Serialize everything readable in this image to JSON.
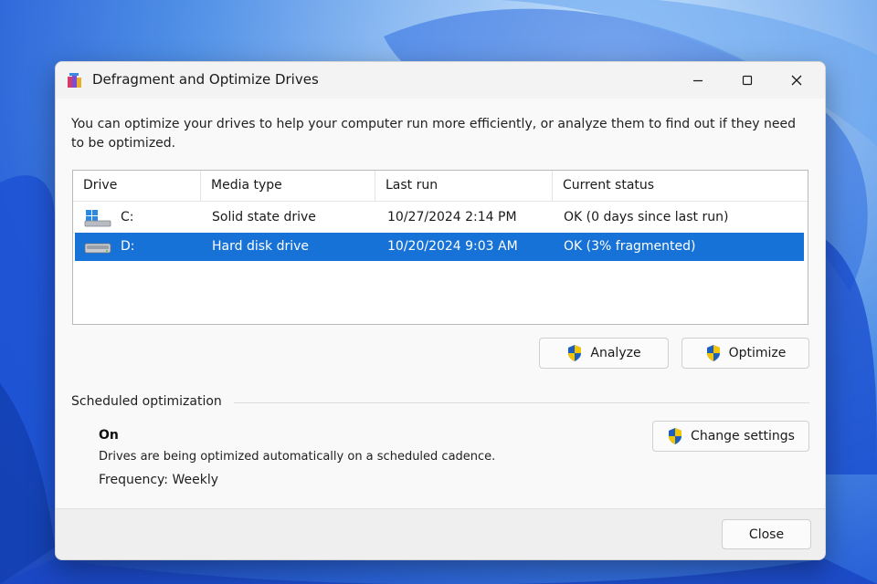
{
  "window": {
    "title": "Defragment and Optimize Drives",
    "controls": {
      "minimize": "minimize",
      "maximize": "maximize",
      "close": "close"
    }
  },
  "description": "You can optimize your drives to help your computer run more efficiently, or analyze them to find out if they need to be optimized.",
  "drives": {
    "columns": [
      "Drive",
      "Media type",
      "Last run",
      "Current status"
    ],
    "rows": [
      {
        "drive": "C:",
        "icon": "windows-drive-icon",
        "media_type": "Solid state drive",
        "last_run": "10/27/2024 2:14 PM",
        "status": "OK (0 days since last run)",
        "selected": false
      },
      {
        "drive": "D:",
        "icon": "hard-disk-icon",
        "media_type": "Hard disk drive",
        "last_run": "10/20/2024 9:03 AM",
        "status": "OK (3% fragmented)",
        "selected": true
      }
    ]
  },
  "buttons": {
    "analyze": "Analyze",
    "optimize": "Optimize",
    "change_settings": "Change settings",
    "close": "Close"
  },
  "scheduled": {
    "heading": "Scheduled optimization",
    "state": "On",
    "description": "Drives are being optimized automatically on a scheduled cadence.",
    "frequency": "Frequency: Weekly"
  },
  "colors": {
    "selection": "#1672d6",
    "shield_blue": "#1d5fbf",
    "shield_yellow": "#f5c400"
  }
}
